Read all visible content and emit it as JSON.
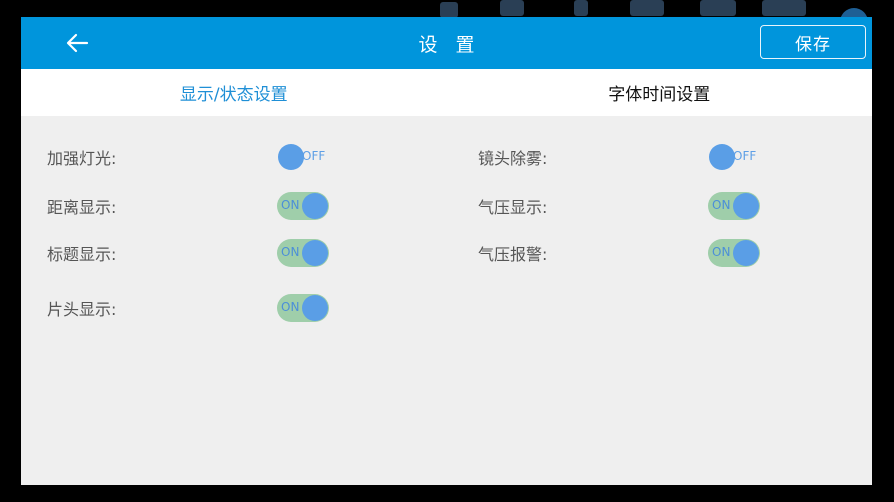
{
  "header": {
    "title": "设 置",
    "save_label": "保存"
  },
  "tabs": [
    {
      "label": "显示/状态设置",
      "active": true
    },
    {
      "label": "字体时间设置",
      "active": false
    }
  ],
  "settings": {
    "left": [
      {
        "label": "加强灯光:",
        "state": "OFF"
      },
      {
        "label": "距离显示:",
        "state": "ON"
      },
      {
        "label": "标题显示:",
        "state": "ON"
      },
      {
        "label": "片头显示:",
        "state": "ON"
      }
    ],
    "right": [
      {
        "label": "镜头除雾:",
        "state": "OFF"
      },
      {
        "label": "气压显示:",
        "state": "ON"
      },
      {
        "label": "气压报警:",
        "state": "ON"
      }
    ]
  },
  "colors": {
    "accent": "#0095dc",
    "active_tab": "#1f8fd6",
    "toggle_on_track": "#9fceaa",
    "toggle_knob": "#5a9ee6"
  },
  "icons": {
    "back": "arrow-left-icon"
  }
}
